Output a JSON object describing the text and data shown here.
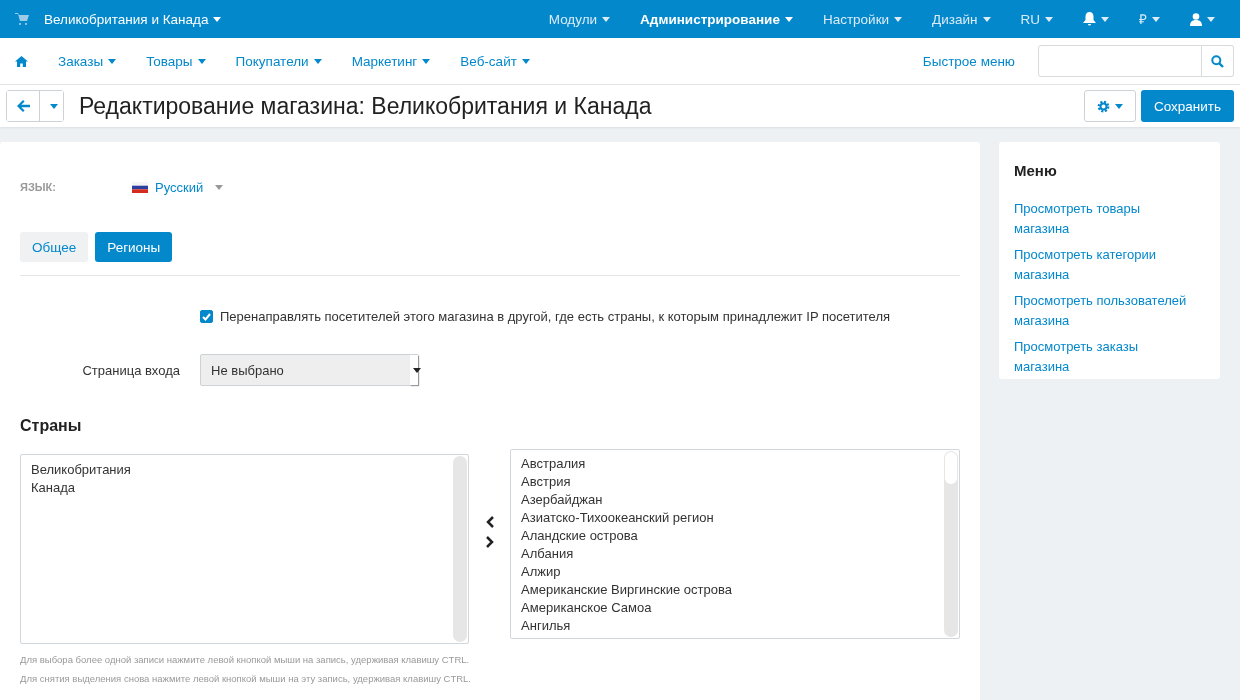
{
  "top_bar": {
    "store": "Великобритания и Канада",
    "menu": [
      {
        "label": "Модули",
        "selected": false
      },
      {
        "label": "Администрирование",
        "selected": true
      },
      {
        "label": "Настройки",
        "selected": false
      },
      {
        "label": "Дизайн",
        "selected": false
      },
      {
        "label": "RU",
        "selected": false
      }
    ],
    "currency": "₽"
  },
  "nav": {
    "items": [
      "Заказы",
      "Товары",
      "Покупатели",
      "Маркетинг",
      "Веб-сайт"
    ],
    "quick_menu": "Быстрое меню"
  },
  "toolbar": {
    "title": "Редактирование магазина: Великобритания и Канада",
    "save": "Сохранить"
  },
  "form": {
    "language_label": "ЯЗЫК:",
    "language": "Русский",
    "tabs": [
      {
        "label": "Общее",
        "selected": false
      },
      {
        "label": "Регионы",
        "selected": true
      }
    ],
    "redirect": {
      "label": "Перенаправлять посетителей этого магазина в другой, где есть страны, к которым принадлежит IP посетителя",
      "checked": true
    },
    "entry_page": {
      "label": "Страница входа",
      "value": "Не выбрано"
    },
    "countries_title": "Страны",
    "selected_countries": [
      "Великобритания",
      "Канада"
    ],
    "available_countries": [
      "Австралия",
      "Австрия",
      "Азербайджан",
      "Азиатско-Тихоокеанский регион",
      "Аландские острова",
      "Албания",
      "Алжир",
      "Американские Виргинские острова",
      "Американское Самоа",
      "Ангилья"
    ],
    "hints": [
      "Для выбора более одной записи нажмите левой кнопкой мыши на запись, удерживая клавишу CTRL.",
      "Для снятия выделения снова нажмите левой кнопкой мыши на эту запись, удерживая клавишу CTRL."
    ]
  },
  "sidebar": {
    "title": "Меню",
    "links": [
      "Просмотреть товары магазина",
      "Просмотреть категории магазина",
      "Просмотреть пользователей магазина",
      "Просмотреть заказы магазина"
    ]
  }
}
